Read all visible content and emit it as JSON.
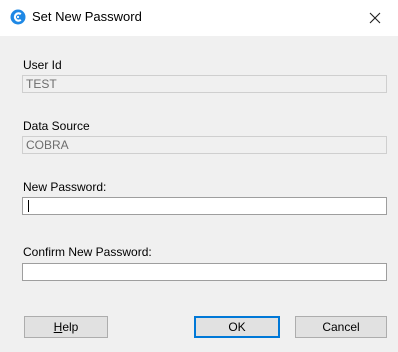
{
  "window": {
    "title": "Set New Password",
    "icon": "cobra-app-icon",
    "close_icon": "close-icon",
    "accent_color": "#0078d7"
  },
  "fields": {
    "user_id": {
      "label": "User Id",
      "value": "TEST"
    },
    "data_source": {
      "label": "Data Source",
      "value": "COBRA"
    },
    "new_password": {
      "label": "New Password:",
      "value": ""
    },
    "confirm_password": {
      "label": "Confirm New Password:",
      "value": ""
    }
  },
  "buttons": {
    "help": {
      "accel": "H",
      "rest": "elp"
    },
    "ok": "OK",
    "cancel": "Cancel"
  }
}
